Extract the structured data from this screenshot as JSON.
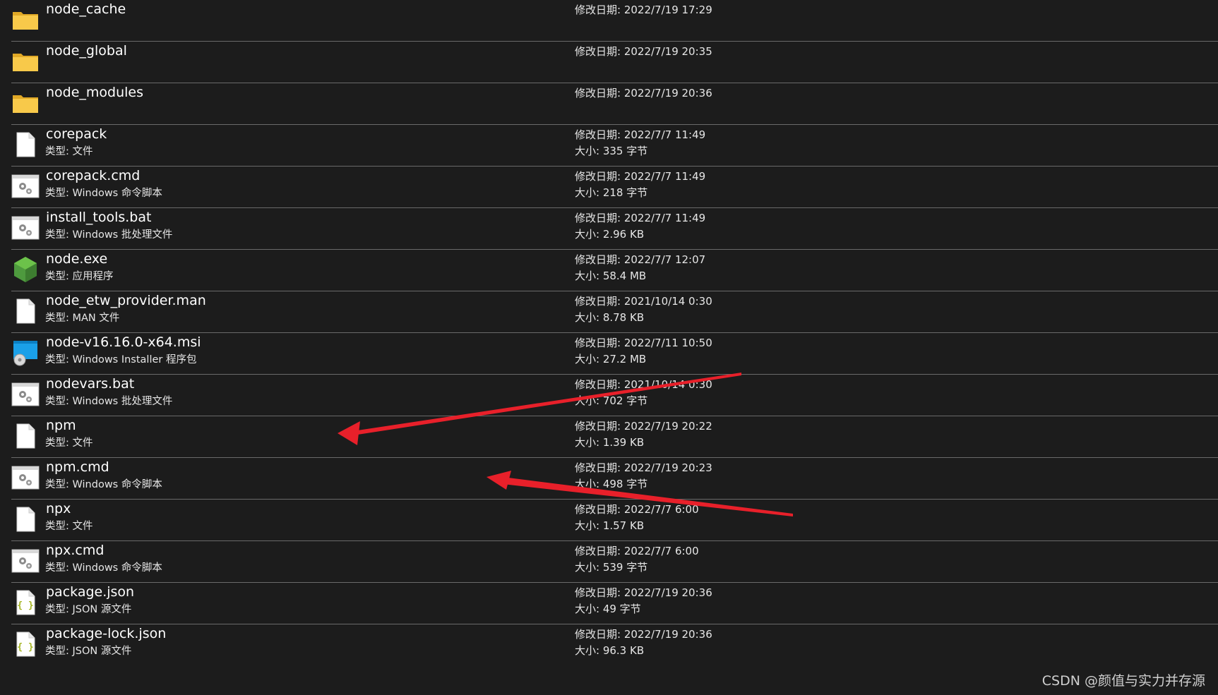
{
  "labels": {
    "type_prefix": "类型: ",
    "date_prefix": "修改日期: ",
    "size_prefix": "大小: "
  },
  "files": [
    {
      "name": "node_cache",
      "icon": "folder-icon",
      "type": "",
      "date": "2022/7/19 17:29",
      "size": ""
    },
    {
      "name": "node_global",
      "icon": "folder-icon",
      "type": "",
      "date": "2022/7/19 20:35",
      "size": ""
    },
    {
      "name": "node_modules",
      "icon": "folder-icon",
      "type": "",
      "date": "2022/7/19 20:36",
      "size": ""
    },
    {
      "name": "corepack",
      "icon": "blank-file-icon",
      "type": "文件",
      "date": "2022/7/7 11:49",
      "size": "335 字节"
    },
    {
      "name": "corepack.cmd",
      "icon": "script-gear-icon",
      "type": "Windows 命令脚本",
      "date": "2022/7/7 11:49",
      "size": "218 字节"
    },
    {
      "name": "install_tools.bat",
      "icon": "script-gear-icon",
      "type": "Windows 批处理文件",
      "date": "2022/7/7 11:49",
      "size": "2.96 KB"
    },
    {
      "name": "node.exe",
      "icon": "node-hexagon-icon",
      "type": "应用程序",
      "date": "2022/7/7 12:07",
      "size": "58.4 MB"
    },
    {
      "name": "node_etw_provider.man",
      "icon": "blank-file-icon",
      "type": "MAN 文件",
      "date": "2021/10/14 0:30",
      "size": "8.78 KB"
    },
    {
      "name": "node-v16.16.0-x64.msi",
      "icon": "installer-icon",
      "type": "Windows Installer 程序包",
      "date": "2022/7/11 10:50",
      "size": "27.2 MB"
    },
    {
      "name": "nodevars.bat",
      "icon": "script-gear-icon",
      "type": "Windows 批处理文件",
      "date": "2021/10/14 0:30",
      "size": "702 字节"
    },
    {
      "name": "npm",
      "icon": "blank-file-icon",
      "type": "文件",
      "date": "2022/7/19 20:22",
      "size": "1.39 KB"
    },
    {
      "name": "npm.cmd",
      "icon": "script-gear-icon",
      "type": "Windows 命令脚本",
      "date": "2022/7/19 20:23",
      "size": "498 字节"
    },
    {
      "name": "npx",
      "icon": "blank-file-icon",
      "type": "文件",
      "date": "2022/7/7 6:00",
      "size": "1.57 KB"
    },
    {
      "name": "npx.cmd",
      "icon": "script-gear-icon",
      "type": "Windows 命令脚本",
      "date": "2022/7/7 6:00",
      "size": "539 字节"
    },
    {
      "name": "package.json",
      "icon": "json-file-icon",
      "type": "JSON 源文件",
      "date": "2022/7/19 20:36",
      "size": "49 字节"
    },
    {
      "name": "package-lock.json",
      "icon": "json-file-icon",
      "type": "JSON 源文件",
      "date": "2022/7/19 20:36",
      "size": "96.3 KB"
    }
  ],
  "watermark": "CSDN @颜值与实力并存源",
  "colors": {
    "background": "#1c1c1c",
    "separator": "#6a6a6a",
    "annotation_arrow": "#e8202a",
    "folder": "#f5c342"
  }
}
